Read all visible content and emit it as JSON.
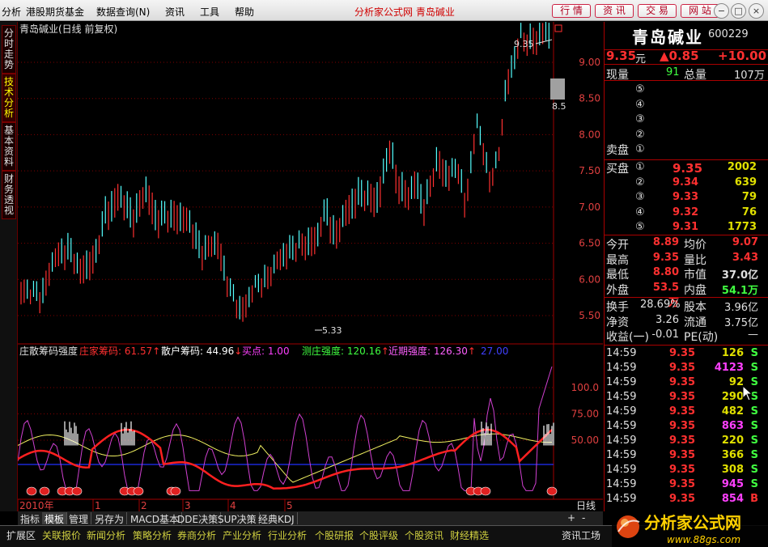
{
  "menubar": {
    "items": [
      "分析",
      "港股期货基金",
      "数据查询(N)",
      "资讯",
      "工具",
      "帮助"
    ],
    "app_title": "分析家公式网 青岛碱业",
    "right_buttons": [
      "行 情",
      "资 讯",
      "交 易",
      "网 站"
    ],
    "window_buttons": [
      "−",
      "□",
      "×"
    ]
  },
  "left_tabs": [
    "分时走势",
    "技术分析",
    "基本资料",
    "财务透视"
  ],
  "main_chart": {
    "title": "青岛碱业(日线 前复权)",
    "high_annotation": "9.35",
    "low_annotation": "5.33",
    "right_edge_label": "8.5",
    "y_ticks": [
      "9.00",
      "8.50",
      "8.00",
      "7.50",
      "7.00",
      "6.50",
      "6.00",
      "5.50"
    ]
  },
  "indicator": {
    "name": "庄散筹码强度",
    "readouts": [
      {
        "label": "庄家筹码: 61.57",
        "color": "#ff3030",
        "arrow": "↑"
      },
      {
        "label": "散户筹码: 44.96",
        "color": "#ffffff",
        "arrow": "↓"
      },
      {
        "label": "买点: 1.00",
        "color": "#ff40ff",
        "arrow": ""
      },
      {
        "label": "测庄强度: 120.16",
        "color": "#40ff40",
        "arrow": "↑"
      },
      {
        "label": "近期强度: 126.30",
        "color": "#ff60ff",
        "arrow": "↑"
      },
      {
        "label": "27.00",
        "color": "#4040ff",
        "arrow": ""
      }
    ],
    "y_ticks": [
      "100.0",
      "75.00",
      "50.00"
    ]
  },
  "x_axis": {
    "labels": [
      "2010年",
      "1",
      "2",
      "3",
      "4",
      "5"
    ],
    "period": "日线"
  },
  "quote": {
    "name": "青岛碱业",
    "code": "600229",
    "price": "9.35",
    "price_unit": "元",
    "change": "▲0.85",
    "pct": "+10.00",
    "volume_label": "现量",
    "volume": "91",
    "total_label": "总量",
    "total": "107万",
    "sell_label": "卖盘",
    "buy_label": "买盘",
    "sell_levels": [
      "⑤",
      "④",
      "③",
      "②",
      "①"
    ],
    "buy_levels": [
      {
        "n": "①",
        "price": "9.35",
        "vol": "2002"
      },
      {
        "n": "②",
        "price": "9.34",
        "vol": "639"
      },
      {
        "n": "③",
        "price": "9.33",
        "vol": "79"
      },
      {
        "n": "④",
        "price": "9.32",
        "vol": "76"
      },
      {
        "n": "⑤",
        "price": "9.31",
        "vol": "1773"
      }
    ],
    "stats": [
      [
        "今开",
        "8.89",
        "均价",
        "9.07"
      ],
      [
        "最高",
        "9.35",
        "量比",
        "3.43"
      ],
      [
        "最低",
        "8.80",
        "市值",
        "37.0亿"
      ],
      [
        "外盘",
        "53.5万",
        "内盘",
        "54.1万"
      ]
    ],
    "stats2": [
      [
        "换手",
        "28.69%",
        "股本",
        "3.96亿"
      ],
      [
        "净资",
        "3.26",
        "流通",
        "3.75亿"
      ],
      [
        "收益(一)",
        "-0.01",
        "PE(动)",
        "—"
      ]
    ],
    "trades": [
      {
        "time": "14:59",
        "price": "9.35",
        "vol": "126",
        "bs": "S",
        "vc": "#e0e000"
      },
      {
        "time": "14:59",
        "price": "9.35",
        "vol": "4123",
        "bs": "S",
        "vc": "#ff40ff"
      },
      {
        "time": "14:59",
        "price": "9.35",
        "vol": "92",
        "bs": "S",
        "vc": "#e0e000"
      },
      {
        "time": "14:59",
        "price": "9.35",
        "vol": "290",
        "bs": "S",
        "vc": "#e0e000"
      },
      {
        "time": "14:59",
        "price": "9.35",
        "vol": "482",
        "bs": "S",
        "vc": "#e0e000"
      },
      {
        "time": "14:59",
        "price": "9.35",
        "vol": "863",
        "bs": "S",
        "vc": "#ff40ff"
      },
      {
        "time": "14:59",
        "price": "9.35",
        "vol": "220",
        "bs": "S",
        "vc": "#e0e000"
      },
      {
        "time": "14:59",
        "price": "9.35",
        "vol": "366",
        "bs": "S",
        "vc": "#e0e000"
      },
      {
        "time": "14:59",
        "price": "9.35",
        "vol": "308",
        "bs": "S",
        "vc": "#e0e000"
      },
      {
        "time": "14:59",
        "price": "9.35",
        "vol": "945",
        "bs": "S",
        "vc": "#ff40ff"
      },
      {
        "time": "14:59",
        "price": "9.35",
        "vol": "854",
        "bs": "B",
        "vc": "#ff40ff"
      }
    ]
  },
  "bottom_tabs": [
    "指标",
    "模板",
    "管理",
    "另存为",
    "MACD基本",
    "DDE决策",
    "SUP决策",
    "经典KDJ"
  ],
  "chart_controls": [
    "+",
    "-"
  ],
  "status_items": [
    "扩展区",
    "关联报价",
    "新闻分析",
    "策略分析",
    "券商分析",
    "产业分析",
    "行业分析",
    "个股研报",
    "个股评级",
    "个股资讯",
    "财经精选",
    "资讯工场"
  ],
  "watermark": {
    "text": "分析家公式网",
    "url": "www.88gs.com"
  },
  "colors": {
    "up": "#ff3030",
    "down": "#54ffff",
    "accent": "#ffff00",
    "grid": "#800000"
  }
}
